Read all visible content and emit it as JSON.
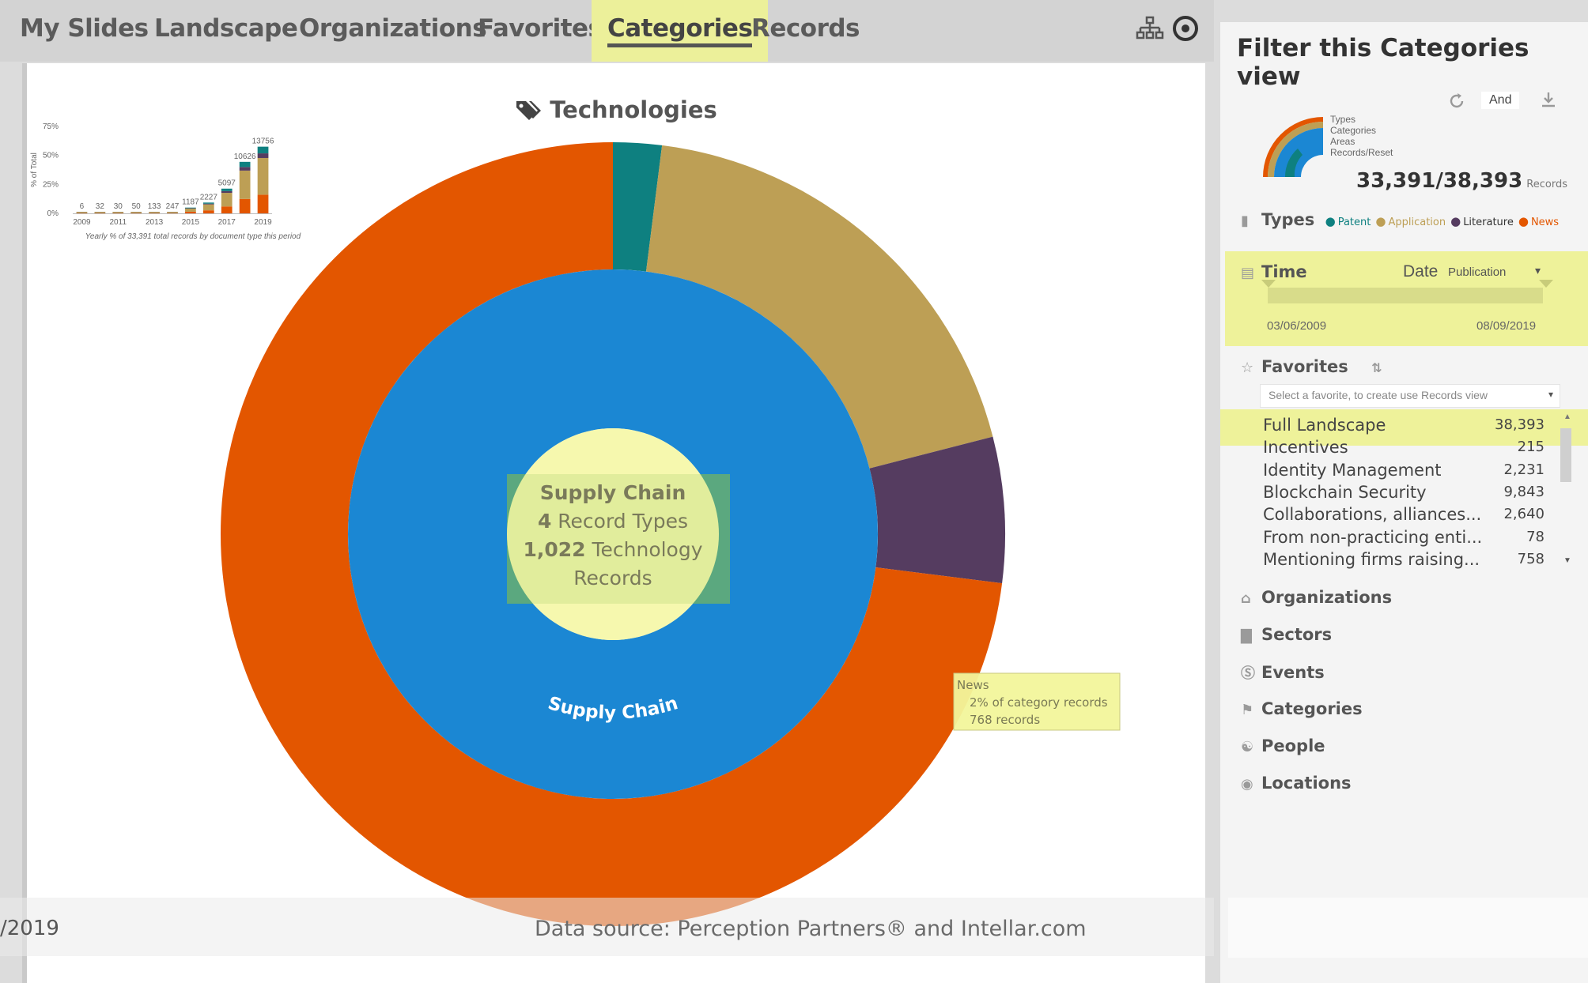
{
  "nav": {
    "items": [
      "My Slides",
      "Landscape",
      "Organizations",
      "Favorites",
      "Categories",
      "Records"
    ],
    "active": "Categories",
    "icons": [
      "hierarchy-icon",
      "target-icon"
    ]
  },
  "chart": {
    "title": "Technologies",
    "center": {
      "line1": "Supply Chain",
      "line2_num": "4",
      "line2_text": " Record Types",
      "line3_num": "1,022",
      "line3_text": " Technology",
      "line4": "Records"
    },
    "inner_label": "Supply Chain",
    "tooltip": {
      "title": "News",
      "line1": "2% of category records",
      "line2": "768 records"
    }
  },
  "chart_data": [
    {
      "type": "pie",
      "title": "Technologies",
      "inner_ring": [
        {
          "label": "Supply Chain",
          "value": 100
        }
      ],
      "outer_ring": [
        {
          "label": "Patent",
          "value": 2,
          "color": "#0e8080"
        },
        {
          "label": "Application",
          "value": 19,
          "color": "#bd9f55"
        },
        {
          "label": "Literature",
          "value": 6,
          "color": "#553c60"
        },
        {
          "label": "News",
          "value": 73,
          "color": "#e35600"
        }
      ]
    },
    {
      "type": "bar",
      "categories": [
        "2009",
        "2010",
        "2011",
        "2012",
        "2013",
        "2014",
        "2015",
        "2016",
        "2017",
        "2018",
        "2019"
      ],
      "x_tick_labels": [
        "2009",
        "2011",
        "2013",
        "2015",
        "2017",
        "2019"
      ],
      "values": [
        6,
        32,
        30,
        50,
        133,
        247,
        1187,
        2227,
        5097,
        10626,
        13756
      ],
      "y_tick_labels": [
        "75%",
        "50%",
        "25%",
        "0%"
      ],
      "ylabel": "% of Total",
      "caption": "Yearly % of 33,391 total records by document type this period"
    }
  ],
  "panel": {
    "title": "Filter this Categories view",
    "logic": "And",
    "legend_items": [
      "Types",
      "Categories",
      "Areas",
      "Records/Reset"
    ],
    "records_filtered": "33,391",
    "records_sep": "/",
    "records_total": "38,393",
    "records_label": "Records",
    "types": {
      "label": "Types",
      "items": [
        {
          "name": "Patent",
          "color": "#0e8080"
        },
        {
          "name": "Application",
          "color": "#bd9f55"
        },
        {
          "name": "Literature",
          "color": "#553c60"
        },
        {
          "name": "News",
          "color": "#e35600"
        }
      ]
    },
    "time": {
      "label": "Time",
      "date_label": "Date",
      "date_type": "Publication",
      "start": "03/06/2009",
      "end": "08/09/2019"
    },
    "favorites": {
      "label": "Favorites",
      "placeholder": "Select a favorite, to create use Records view",
      "items": [
        {
          "name": "Full Landscape",
          "count": "38,393"
        },
        {
          "name": "Incentives",
          "count": "215"
        },
        {
          "name": "Identity Management",
          "count": "2,231"
        },
        {
          "name": "Blockchain Security",
          "count": "9,843"
        },
        {
          "name": "Collaborations, alliances...",
          "count": "2,640"
        },
        {
          "name": "From non-practicing enti...",
          "count": "78"
        },
        {
          "name": "Mentioning firms raising...",
          "count": "758"
        }
      ]
    },
    "sections": [
      "Organizations",
      "Sectors",
      "Events",
      "Categories",
      "People",
      "Locations"
    ]
  },
  "footer": {
    "date": "/2019",
    "source": "Data source: Perception Partners® and Intellar.com"
  }
}
